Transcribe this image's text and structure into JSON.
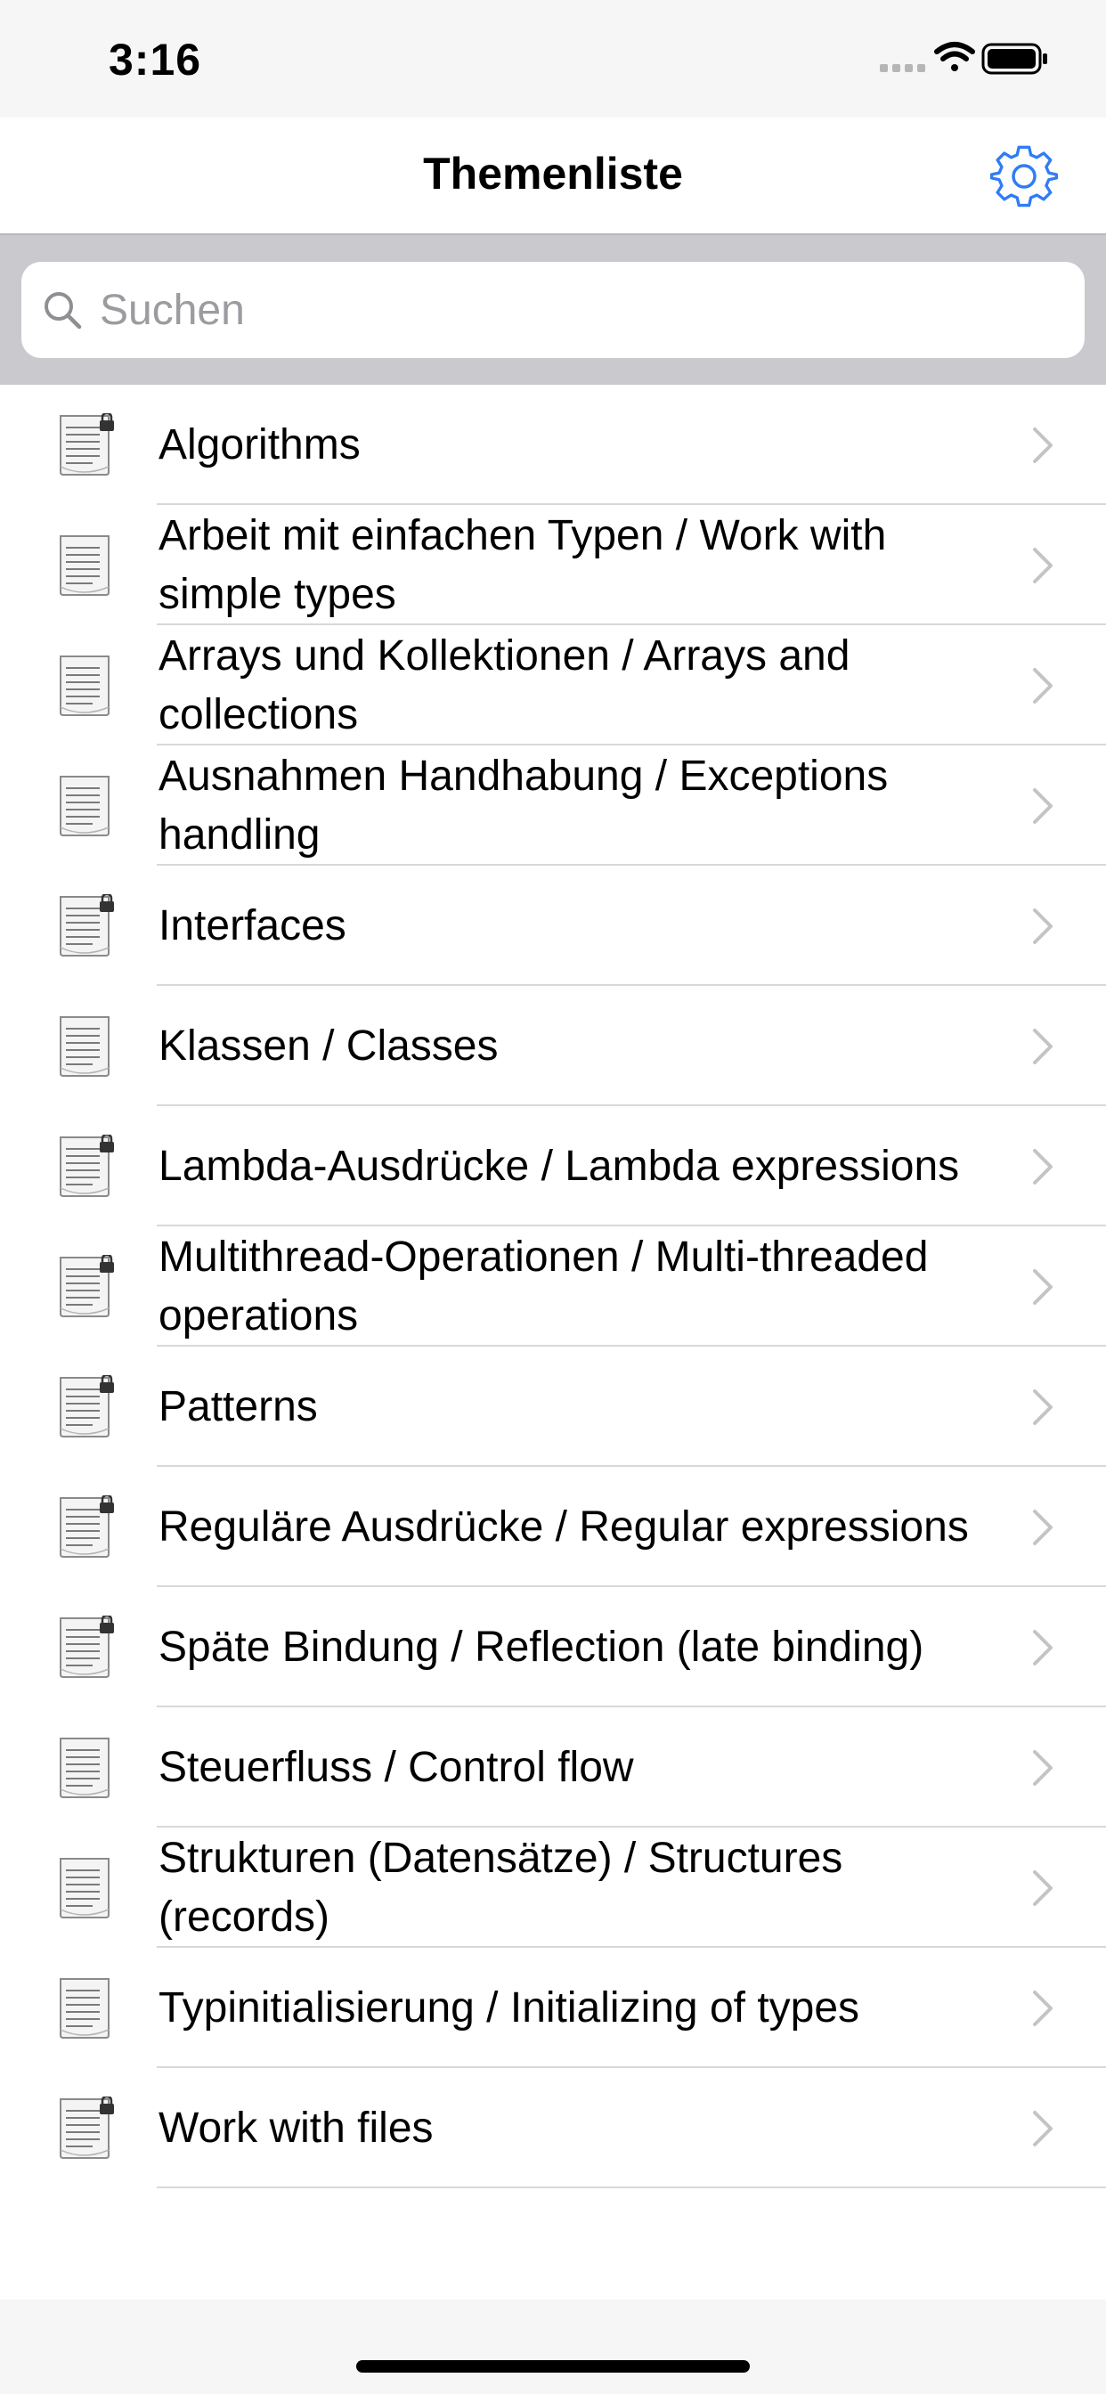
{
  "status_bar": {
    "time": "3:16"
  },
  "nav": {
    "title": "Themenliste",
    "settings_icon": "gear-icon",
    "accent": "#2f7cf6"
  },
  "search": {
    "placeholder": "Suchen",
    "value": ""
  },
  "topics": [
    {
      "label": "Algorithms",
      "locked": true
    },
    {
      "label": "Arbeit mit einfachen Typen / Work with simple types",
      "locked": false
    },
    {
      "label": "Arrays und Kollektionen / Arrays and collections",
      "locked": false
    },
    {
      "label": "Ausnahmen Handhabung / Exceptions handling",
      "locked": false
    },
    {
      "label": "Interfaces",
      "locked": true
    },
    {
      "label": "Klassen / Classes",
      "locked": false
    },
    {
      "label": "Lambda-Ausdrücke / Lambda expressions",
      "locked": true
    },
    {
      "label": "Multithread-Operationen / Multi-threaded operations",
      "locked": true
    },
    {
      "label": "Patterns",
      "locked": true
    },
    {
      "label": "Reguläre Ausdrücke / Regular expressions",
      "locked": true
    },
    {
      "label": "Späte Bindung / Reflection (late binding)",
      "locked": true
    },
    {
      "label": "Steuerfluss / Control flow",
      "locked": false
    },
    {
      "label": "Strukturen (Datensätze) / Structures (records)",
      "locked": false
    },
    {
      "label": "Typinitialisierung / Initializing of types",
      "locked": false
    },
    {
      "label": "Work with files",
      "locked": true
    }
  ]
}
